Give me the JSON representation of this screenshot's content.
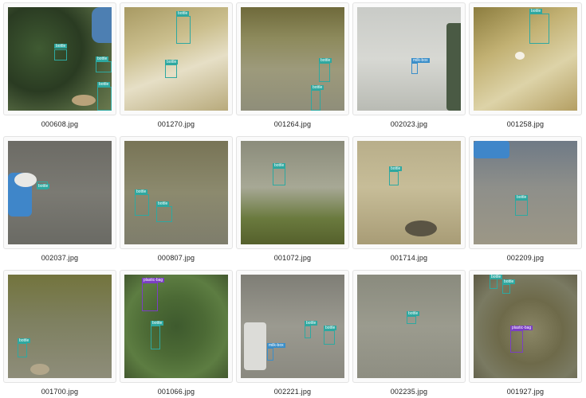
{
  "items": [
    {
      "file": "000608.jpg",
      "labels": [
        "bottle",
        "bottle",
        "bottle"
      ]
    },
    {
      "file": "001270.jpg",
      "labels": [
        "bottle",
        "bottle"
      ]
    },
    {
      "file": "001264.jpg",
      "labels": [
        "bottle",
        "bottle"
      ]
    },
    {
      "file": "002023.jpg",
      "labels": [
        "milk-box"
      ]
    },
    {
      "file": "001258.jpg",
      "labels": [
        "bottle"
      ]
    },
    {
      "file": "002037.jpg",
      "labels": [
        "bottle"
      ]
    },
    {
      "file": "000807.jpg",
      "labels": [
        "bottle",
        "bottle"
      ]
    },
    {
      "file": "001072.jpg",
      "labels": [
        "bottle"
      ]
    },
    {
      "file": "001714.jpg",
      "labels": [
        "bottle"
      ]
    },
    {
      "file": "002209.jpg",
      "labels": [
        "bottle"
      ]
    },
    {
      "file": "001700.jpg",
      "labels": [
        "bottle"
      ]
    },
    {
      "file": "001066.jpg",
      "labels": [
        "plastic-bag",
        "bottle"
      ]
    },
    {
      "file": "002221.jpg",
      "labels": [
        "bottle",
        "bottle",
        "milk-box"
      ]
    },
    {
      "file": "002235.jpg",
      "labels": [
        "bottle"
      ]
    },
    {
      "file": "001927.jpg",
      "labels": [
        "bottle",
        "bottle",
        "plastic-bag"
      ]
    }
  ],
  "colors": {
    "bottle": "#2ea8a0",
    "milk-box": "#3a8ec9",
    "plastic-bag": "#7b3fc4"
  }
}
